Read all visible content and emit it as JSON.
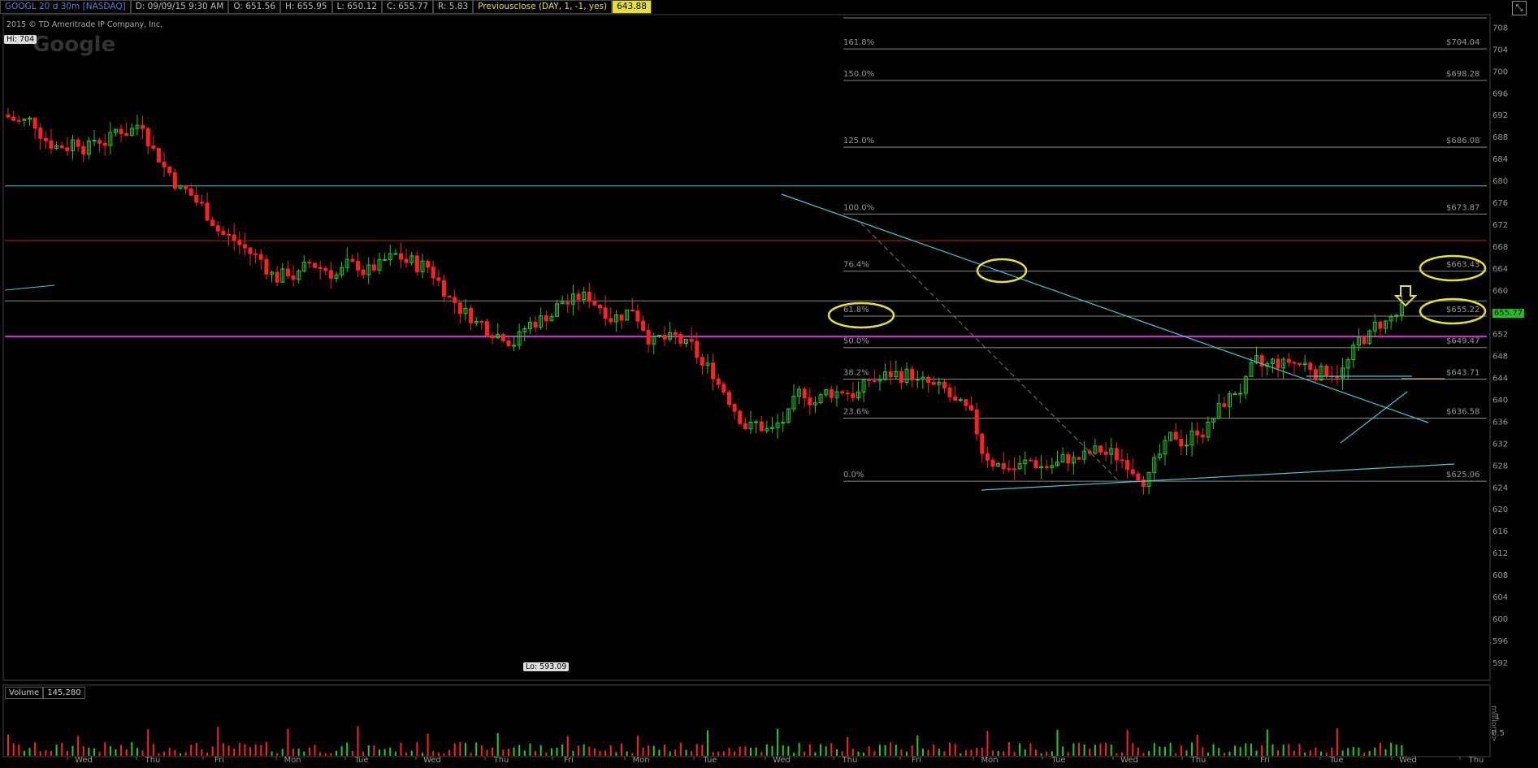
{
  "header": {
    "symbol": "GOOGL 20 d 30m [NASDAQ]",
    "date": "D: 09/09/15 9:30 AM",
    "open": "O: 651.56",
    "high": "H: 655.95",
    "low": "L: 650.12",
    "close": "C: 655.77",
    "range": "R: 5.83",
    "prev_close_label": "Previousclose (DAY, 1, -1, yes)",
    "prev_close_value": "643.88"
  },
  "copyright": "2015 © TD Ameritrade IP Company, Inc.",
  "watermark": "Google",
  "hi_label": "Hi: 704",
  "lo_label": "Lo: 593.09",
  "last_price": "655.77",
  "volume_label": "Volume",
  "volume_value": "145,280",
  "volume_unit": "millions>",
  "colors": {
    "up": "#22cc22",
    "down": "#ff2020",
    "cyan": "#40c8d8",
    "red_line": "#c01818",
    "magenta": "#e020e0",
    "yellow": "#e8e030",
    "fib": "#888888"
  },
  "chart_data": {
    "type": "candlestick",
    "ylim": [
      589,
      710
    ],
    "y_ticks": [
      "708",
      "704",
      "700",
      "696",
      "692",
      "688",
      "684",
      "680",
      "676",
      "672",
      "668",
      "664",
      "660",
      "656",
      "652",
      "648",
      "644",
      "640",
      "636",
      "632",
      "628",
      "624",
      "620",
      "616",
      "612",
      "608",
      "604",
      "600",
      "596",
      "592"
    ],
    "x_day_labels": [
      "Wed",
      "Thu",
      "Fri",
      "Mon",
      "Tue",
      "Wed",
      "Thu",
      "Fri",
      "Mon",
      "Tue",
      "Wed",
      "Thu",
      "Fri",
      "Mon",
      "Tue",
      "Wed",
      "Thu",
      "Fri",
      "Tue",
      "Wed",
      "Thu"
    ],
    "session_close": [
      687,
      691,
      673,
      662,
      664,
      664,
      653,
      658,
      657,
      646,
      634,
      642,
      645,
      631,
      628,
      629,
      633,
      646,
      645.5,
      655.77
    ],
    "fib_levels": [
      {
        "pct": "161.8%",
        "price": "$704.04",
        "value": 704.04
      },
      {
        "pct": "150.0%",
        "price": "$698.28",
        "value": 698.28
      },
      {
        "pct": "125.0%",
        "price": "$686.08",
        "value": 686.08
      },
      {
        "pct": "100.0%",
        "price": "$673.87",
        "value": 673.87
      },
      {
        "pct": "76.4%",
        "price": "$663.43",
        "value": 663.43
      },
      {
        "pct": "61.8%",
        "price": "$655.22",
        "value": 655.22
      },
      {
        "pct": "50.0%",
        "price": "$649.47",
        "value": 649.47
      },
      {
        "pct": "38.2%",
        "price": "$643.71",
        "value": 643.71
      },
      {
        "pct": "23.6%",
        "price": "$636.58",
        "value": 636.58
      },
      {
        "pct": "0.0%",
        "price": "$625.06",
        "value": 625.06
      }
    ],
    "horizontal_levels": {
      "cyan": 679,
      "red": 669,
      "magenta": 651.5,
      "support": 658
    },
    "volume_ticks": [
      "1",
      "0.5"
    ]
  }
}
